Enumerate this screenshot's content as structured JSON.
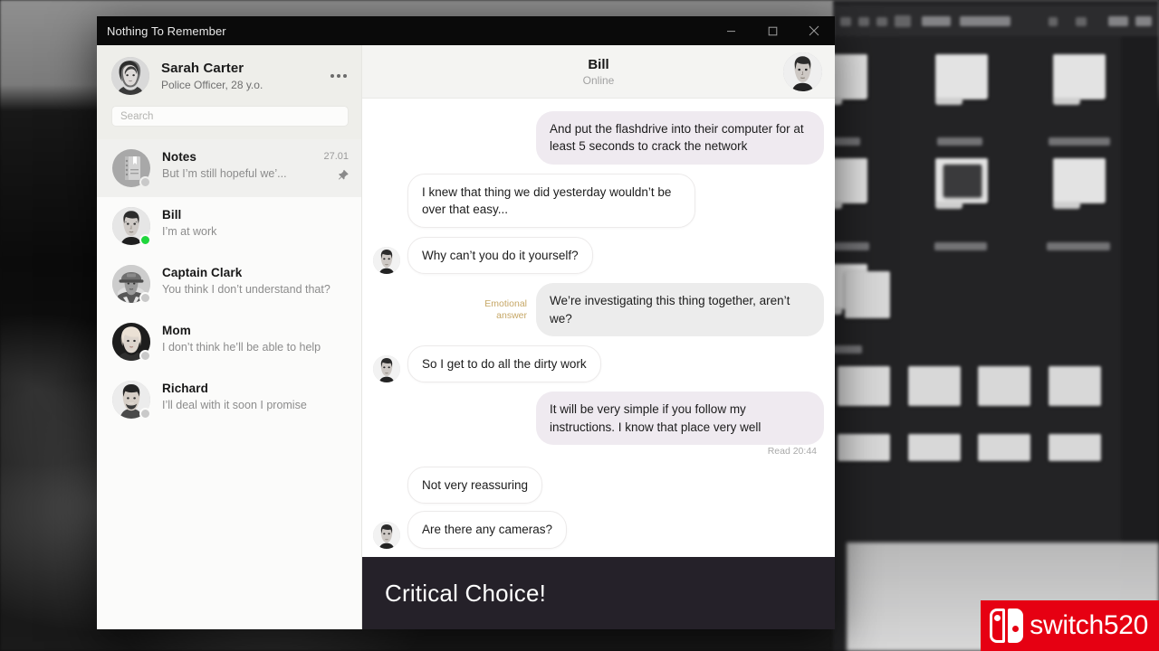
{
  "window": {
    "title": "Nothing To Remember",
    "controls": [
      {
        "name": "minimize",
        "label": "Minimize"
      },
      {
        "name": "maximize",
        "label": "Maximize"
      },
      {
        "name": "close",
        "label": "Close"
      }
    ]
  },
  "sidebar": {
    "profile": {
      "name": "Sarah Carter",
      "subtitle": "Police Officer, 28 y.o.",
      "menu_label": "More options",
      "avatar_name": "sarah-carter-avatar"
    },
    "search": {
      "placeholder": "Search",
      "value": ""
    },
    "contacts": [
      {
        "name": "Notes",
        "snippet": "But I’m still hopeful we’...",
        "time": "27.01",
        "pinned": true,
        "selected": true,
        "status": "offline",
        "avatar": "notes-avatar"
      },
      {
        "name": "Bill",
        "snippet": "I’m at work",
        "time": "",
        "pinned": false,
        "selected": false,
        "status": "online",
        "avatar": "bill-avatar"
      },
      {
        "name": "Captain Clark",
        "snippet": "You think I don’t understand that?",
        "time": "",
        "pinned": false,
        "selected": false,
        "status": "offline",
        "avatar": "captain-clark-avatar"
      },
      {
        "name": "Mom",
        "snippet": "I don’t think he’ll be able to help",
        "time": "",
        "pinned": false,
        "selected": false,
        "status": "offline",
        "avatar": "mom-avatar"
      },
      {
        "name": "Richard",
        "snippet": "I’ll deal with it soon I promise",
        "time": "",
        "pinned": false,
        "selected": false,
        "status": "offline",
        "avatar": "richard-avatar"
      }
    ]
  },
  "chat": {
    "title": "Bill",
    "status": "Online",
    "avatar_name": "bill-header-avatar",
    "messages": [
      {
        "id": "m1",
        "direction": "out",
        "text": "And put the flashdrive into their computer for at least 5 seconds to crack the network",
        "style": "lavender",
        "tag": "",
        "avatar": false,
        "receipt": ""
      },
      {
        "id": "m2",
        "direction": "in",
        "text": "I knew that thing we did yesterday wouldn’t be over that easy...",
        "style": "plain",
        "tag": "",
        "avatar": false,
        "receipt": ""
      },
      {
        "id": "m3",
        "direction": "in",
        "text": "Why can’t you do it yourself?",
        "style": "plain",
        "tag": "",
        "avatar": true,
        "receipt": ""
      },
      {
        "id": "m4",
        "direction": "out",
        "text": "We’re investigating this thing together, aren’t we?",
        "style": "gray",
        "tag": "Emotional\nanswer",
        "avatar": false,
        "receipt": ""
      },
      {
        "id": "m5",
        "direction": "in",
        "text": "So I get to do all the dirty work",
        "style": "plain",
        "tag": "",
        "avatar": true,
        "receipt": ""
      },
      {
        "id": "m6",
        "direction": "out",
        "text": "It will be very simple if you follow my instructions. I know that place very well",
        "style": "lavender",
        "tag": "",
        "avatar": false,
        "receipt": "Read 20:44"
      },
      {
        "id": "m7",
        "direction": "in",
        "text": "Not very reassuring",
        "style": "plain",
        "tag": "",
        "avatar": false,
        "receipt": ""
      },
      {
        "id": "m8",
        "direction": "in",
        "text": "Are there any cameras?",
        "style": "plain",
        "tag": "",
        "avatar": true,
        "receipt": ""
      }
    ]
  },
  "banner": {
    "text": "Critical Choice!"
  },
  "watermark": {
    "text": "switch520"
  },
  "colors": {
    "titlebar": "#0a0a0a",
    "sidebar_bg": "#f7f7f5",
    "outgoing_lavender": "#efeaf0",
    "outgoing_gray": "#ececec",
    "online_dot": "#1fd63c",
    "emotional_tag": "#c6a766",
    "banner_bg": "#252129",
    "watermark_red": "#e60012"
  }
}
